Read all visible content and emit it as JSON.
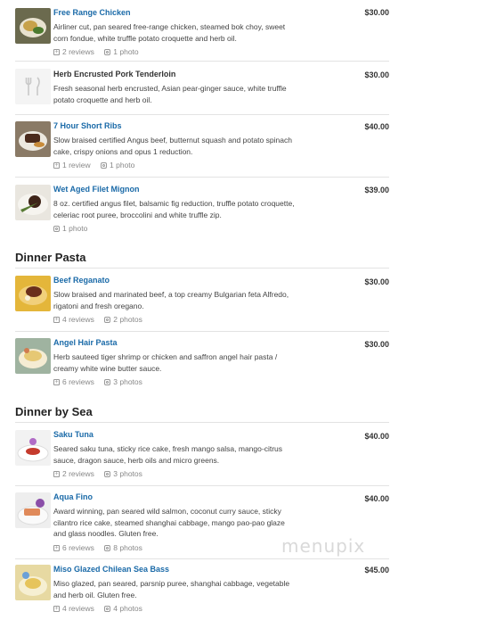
{
  "sections": [
    {
      "title": "",
      "items": [
        {
          "name": "Free Range Chicken",
          "price": "$30.00",
          "desc": "Airliner cut, pan seared free-range chicken, steamed bok choy, sweet corn fondue, white truffle potato croquette and herb oil.",
          "reviews": "2 reviews",
          "photos": "1 photo",
          "thumb": "food-photo"
        },
        {
          "name": "Herb Encrusted Pork Tenderloin",
          "price": "$30.00",
          "desc": "Fresh seasonal herb encrusted, Asian pear-ginger sauce, white truffle potato croquette and herb oil.",
          "reviews": "",
          "photos": "",
          "thumb": "fork-knife-icon"
        },
        {
          "name": "7 Hour Short Ribs",
          "price": "$40.00",
          "desc": "Slow braised certified Angus beef, butternut squash and potato spinach cake, crispy onions and opus 1 reduction.",
          "reviews": "1 review",
          "photos": "1 photo",
          "thumb": "food-photo"
        },
        {
          "name": "Wet Aged Filet Mignon",
          "price": "$39.00",
          "desc": "8 oz. certified angus filet, balsamic fig reduction, truffle potato croquette, celeriac root puree, broccolini and white truffle zip.",
          "reviews": "",
          "photos": "1 photo",
          "thumb": "food-photo"
        }
      ]
    },
    {
      "title": "Dinner Pasta",
      "items": [
        {
          "name": "Beef Reganato",
          "price": "$30.00",
          "desc": "Slow braised and marinated beef, a top creamy Bulgarian feta Alfredo, rigatoni and fresh oregano.",
          "reviews": "4 reviews",
          "photos": "2 photos",
          "thumb": "food-photo"
        },
        {
          "name": "Angel Hair Pasta",
          "price": "$30.00",
          "desc": "Herb sauteed tiger shrimp or chicken and saffron angel hair pasta / creamy white wine butter sauce.",
          "reviews": "6 reviews",
          "photos": "3 photos",
          "thumb": "food-photo"
        }
      ]
    },
    {
      "title": "Dinner by Sea",
      "items": [
        {
          "name": "Saku Tuna",
          "price": "$40.00",
          "desc": "Seared saku tuna, sticky rice cake, fresh mango salsa, mango-citrus sauce, dragon sauce, herb oils and micro greens.",
          "reviews": "2 reviews",
          "photos": "3 photos",
          "thumb": "food-photo"
        },
        {
          "name": "Aqua Fino",
          "price": "$40.00",
          "desc": "Award winning, pan seared wild salmon, coconut curry sauce, sticky cilantro rice cake, steamed shanghai cabbage, mango pao-pao glaze and glass noodles. Gluten free.",
          "reviews": "6 reviews",
          "photos": "8 photos",
          "thumb": "food-photo"
        },
        {
          "name": "Miso Glazed Chilean Sea Bass",
          "price": "$45.00",
          "desc": "Miso glazed, pan seared, parsnip puree, shanghai cabbage, vegetable and herb oil. Gluten free.",
          "reviews": "4 reviews",
          "photos": "4 photos",
          "thumb": "food-photo"
        }
      ]
    }
  ],
  "watermark": "menupix",
  "colors": {
    "link": "#1a6aa8",
    "divider": "#e3e3e3",
    "meta": "#888888"
  }
}
